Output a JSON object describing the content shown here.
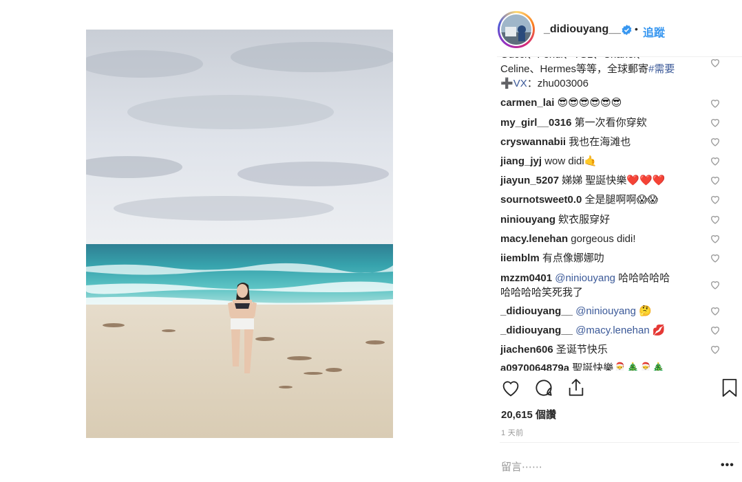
{
  "post": {
    "username": "_didiouyang__",
    "follow_label": "追蹤",
    "separator": "•"
  },
  "caption_partial": {
    "line0": "Gucci、Fendi、YSL、Chanel、",
    "line1": "Celine、Hermes等等，全球郵寄",
    "line1_tag": "#需要",
    "line2_prefix": "➕",
    "line2_tag": "VX",
    "line2_rest": "：zhu003006"
  },
  "comments": [
    {
      "user": "carmen_lai",
      "text": "",
      "emoji": "😎😎😎😎😎😎"
    },
    {
      "user": "my_girl__0316",
      "text": "第一次看你穿欸",
      "emoji": ""
    },
    {
      "user": "cryswannabii",
      "text": "我也在海滩也",
      "emoji": ""
    },
    {
      "user": "jiang_jyj",
      "text": "wow didi",
      "emoji": "🤙"
    },
    {
      "user": "jiayun_5207",
      "text": "娣娣 聖誕快樂",
      "emoji": "❤️❤️❤️"
    },
    {
      "user": "sournotsweet0.0",
      "text": "全是腿啊啊",
      "emoji": "😱😱"
    },
    {
      "user": "niniouyang",
      "text": "欸衣服穿好",
      "emoji": ""
    },
    {
      "user": "macy.lenehan",
      "text": "gorgeous didi!",
      "emoji": ""
    },
    {
      "user": "iiemblm",
      "text": "有点像娜娜叻",
      "emoji": ""
    },
    {
      "user": "mzzm0401",
      "mention": "@niniouyang",
      "text": "哈哈哈哈哈",
      "text2": "哈哈哈哈笑死我了"
    },
    {
      "user": "_didiouyang__",
      "mention": "@niniouyang",
      "emoji": "🤔"
    },
    {
      "user": "_didiouyang__",
      "mention": "@macy.lenehan",
      "emoji": "💋"
    },
    {
      "user": "jiachen606",
      "text": "圣诞节快乐",
      "emoji": ""
    },
    {
      "user": "a0970064879a",
      "text": "聖誕快樂",
      "emoji": "🎅🎄🎅🎄"
    }
  ],
  "likes_label": "20,615 個讚",
  "time_label": "1 天前",
  "add_comment_placeholder": "留言⋯⋯",
  "more_label": "•••",
  "icons": {
    "like": "heart-icon",
    "comment": "comment-icon",
    "share": "share-icon",
    "save": "bookmark-icon",
    "verified": "verified-badge-icon"
  },
  "colors": {
    "link_blue": "#3897f0",
    "mention_blue": "#3b5998",
    "text": "#262626",
    "muted": "#999999"
  }
}
